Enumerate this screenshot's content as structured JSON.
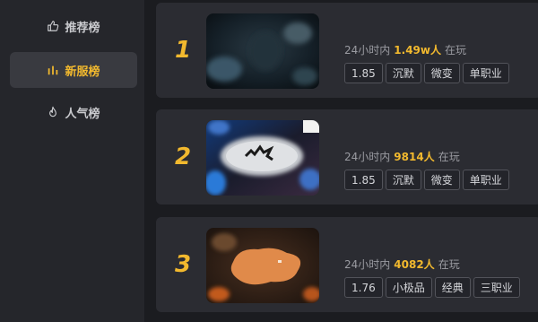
{
  "sidebar": {
    "items": [
      {
        "label": "推荐榜",
        "icon": "thumbs-up-icon",
        "active": false
      },
      {
        "label": "新服榜",
        "icon": "bar-chart-icon",
        "active": true
      },
      {
        "label": "人气榜",
        "icon": "flame-icon",
        "active": false
      }
    ]
  },
  "games": [
    {
      "rank": "1",
      "prefix": "24小时内",
      "count": "1.49w人",
      "suffix": "在玩",
      "tags": [
        "1.85",
        "沉默",
        "微变",
        "单职业"
      ]
    },
    {
      "rank": "2",
      "prefix": "24小时内",
      "count": "9814人",
      "suffix": "在玩",
      "tags": [
        "1.85",
        "沉默",
        "微变",
        "单职业"
      ]
    },
    {
      "rank": "3",
      "prefix": "24小时内",
      "count": "4082人",
      "suffix": "在玩",
      "tags": [
        "1.76",
        "小极品",
        "经典",
        "三职业"
      ]
    }
  ],
  "colors": {
    "accent": "#f2b92e",
    "card": "#2b2c32",
    "sidebar": "#25262b"
  }
}
